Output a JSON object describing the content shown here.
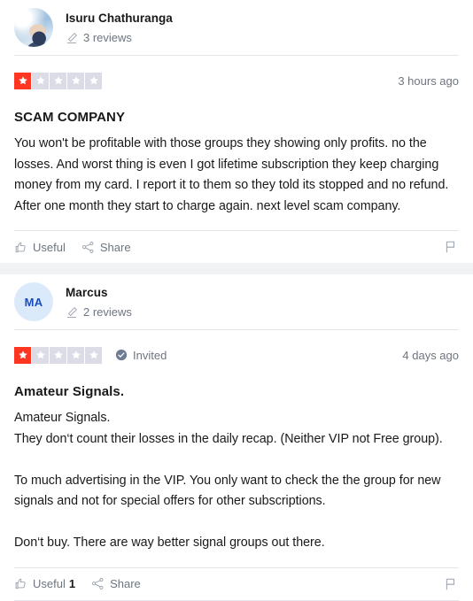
{
  "colors": {
    "star_filled": "#ff3722",
    "star_empty": "#dcdce6",
    "page_background": "#f1f2f4",
    "card_background": "#ffffff",
    "text_primary": "#191919",
    "text_muted": "#6d7580",
    "avatar_initials_bg": "#dbeafb",
    "avatar_initials_fg": "#1b4dbd",
    "invited_badge": "#6d7c93",
    "divider": "#e3e5e8"
  },
  "reviews": [
    {
      "consumer": {
        "name": "Isuru Chathuranga",
        "reviews_count": "3 reviews",
        "avatar_type": "photo",
        "avatar_initials": "",
        "pencil_icon": "pencil-icon"
      },
      "rating": {
        "value": 1,
        "max": 5,
        "label": "Rated 1 out of 5 stars"
      },
      "invited": false,
      "invited_label": "",
      "timestamp": "3 hours ago",
      "title": "SCAM COMPANY",
      "body": "You won't be profitable with those groups they showing only profits. no the losses. And worst thing is even I got lifetime subscription they keep charging money from my card. I report it to them so they told its stopped and no refund. After one month they start to charge again. next level scam company.",
      "actions": {
        "useful_label": "Useful",
        "useful_count": "",
        "share_label": "Share",
        "report_label": "Report"
      }
    },
    {
      "consumer": {
        "name": "Marcus",
        "reviews_count": "2 reviews",
        "avatar_type": "initials",
        "avatar_initials": "MA",
        "pencil_icon": "pencil-icon"
      },
      "rating": {
        "value": 1,
        "max": 5,
        "label": "Rated 1 out of 5 stars"
      },
      "invited": true,
      "invited_label": "Invited",
      "timestamp": "4 days ago",
      "title": "Amateur Signals.",
      "body": "Amateur Signals.\nThey don‘t count their losses in the daily recap. (Neither VIP not Free group).\n\nTo much advertising in the VIP. You only want to check the the group for new signals and not for special offers for other subscriptions.\n\nDon‘t buy. There are way better signal groups out there.",
      "actions": {
        "useful_label": "Useful",
        "useful_count": "1",
        "share_label": "Share",
        "report_label": "Report"
      }
    }
  ]
}
